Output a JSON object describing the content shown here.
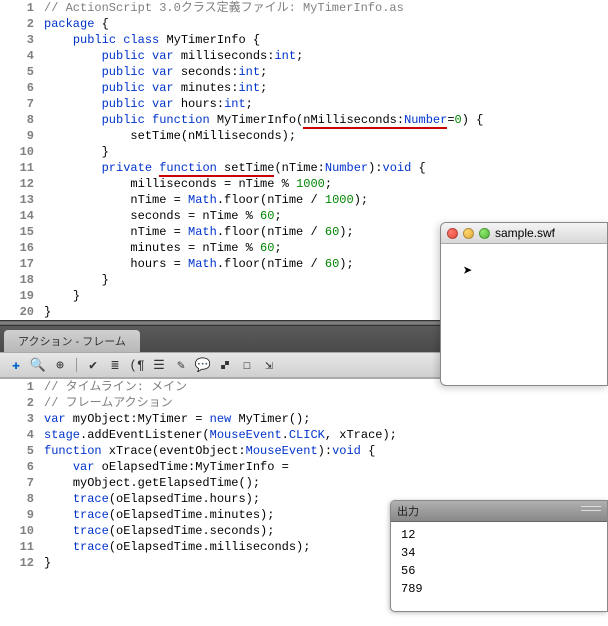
{
  "top_code": [
    {
      "n": 1,
      "tokens": [
        {
          "t": "// ActionScript 3.0クラス定義ファイル: MyTimerInfo.as",
          "c": "cm"
        }
      ],
      "indent": 0
    },
    {
      "n": 2,
      "tokens": [
        {
          "t": "package",
          "c": "kw"
        },
        {
          "t": " {",
          "c": "op"
        }
      ],
      "indent": 0
    },
    {
      "n": 3,
      "tokens": [
        {
          "t": "public",
          "c": "kw"
        },
        {
          "t": " ",
          "c": ""
        },
        {
          "t": "class",
          "c": "kw"
        },
        {
          "t": " MyTimerInfo {",
          "c": "id"
        }
      ],
      "indent": 1
    },
    {
      "n": 4,
      "tokens": [
        {
          "t": "public",
          "c": "kw"
        },
        {
          "t": " ",
          "c": ""
        },
        {
          "t": "var",
          "c": "kw"
        },
        {
          "t": " milliseconds:",
          "c": "id"
        },
        {
          "t": "int",
          "c": "kw"
        },
        {
          "t": ";",
          "c": "op"
        }
      ],
      "indent": 2
    },
    {
      "n": 5,
      "tokens": [
        {
          "t": "public",
          "c": "kw"
        },
        {
          "t": " ",
          "c": ""
        },
        {
          "t": "var",
          "c": "kw"
        },
        {
          "t": " seconds:",
          "c": "id"
        },
        {
          "t": "int",
          "c": "kw"
        },
        {
          "t": ";",
          "c": "op"
        }
      ],
      "indent": 2
    },
    {
      "n": 6,
      "tokens": [
        {
          "t": "public",
          "c": "kw"
        },
        {
          "t": " ",
          "c": ""
        },
        {
          "t": "var",
          "c": "kw"
        },
        {
          "t": " minutes:",
          "c": "id"
        },
        {
          "t": "int",
          "c": "kw"
        },
        {
          "t": ";",
          "c": "op"
        }
      ],
      "indent": 2
    },
    {
      "n": 7,
      "tokens": [
        {
          "t": "public",
          "c": "kw"
        },
        {
          "t": " ",
          "c": ""
        },
        {
          "t": "var",
          "c": "kw"
        },
        {
          "t": " hours:",
          "c": "id"
        },
        {
          "t": "int",
          "c": "kw"
        },
        {
          "t": ";",
          "c": "op"
        }
      ],
      "indent": 2
    },
    {
      "n": 8,
      "tokens": [
        {
          "t": "public",
          "c": "kw"
        },
        {
          "t": " ",
          "c": ""
        },
        {
          "t": "function",
          "c": "kw"
        },
        {
          "t": " MyTimerInfo(",
          "c": "id"
        },
        {
          "t": "nMilliseconds",
          "c": "id err"
        },
        {
          "t": ":",
          "c": "op err"
        },
        {
          "t": "Number",
          "c": "kw err"
        },
        {
          "t": "=",
          "c": "op"
        },
        {
          "t": "0",
          "c": "num"
        },
        {
          "t": ") {",
          "c": "op"
        }
      ],
      "indent": 2
    },
    {
      "n": 9,
      "tokens": [
        {
          "t": "setTime(nMilliseconds);",
          "c": "id"
        }
      ],
      "indent": 3
    },
    {
      "n": 10,
      "tokens": [
        {
          "t": "}",
          "c": "op"
        }
      ],
      "indent": 2
    },
    {
      "n": 11,
      "tokens": [
        {
          "t": "private",
          "c": "kw"
        },
        {
          "t": " ",
          "c": ""
        },
        {
          "t": "function",
          "c": "kw err"
        },
        {
          "t": " ",
          "c": "err"
        },
        {
          "t": "setTime",
          "c": "id err"
        },
        {
          "t": "(nTime:",
          "c": "id"
        },
        {
          "t": "Number",
          "c": "kw"
        },
        {
          "t": "):",
          "c": "op"
        },
        {
          "t": "void",
          "c": "kw"
        },
        {
          "t": " {",
          "c": "op"
        }
      ],
      "indent": 2
    },
    {
      "n": 12,
      "tokens": [
        {
          "t": "milliseconds = nTime % ",
          "c": "id"
        },
        {
          "t": "1000",
          "c": "num"
        },
        {
          "t": ";",
          "c": "op"
        }
      ],
      "indent": 3
    },
    {
      "n": 13,
      "tokens": [
        {
          "t": "nTime = ",
          "c": "id"
        },
        {
          "t": "Math",
          "c": "kw"
        },
        {
          "t": ".floor(nTime / ",
          "c": "id"
        },
        {
          "t": "1000",
          "c": "num"
        },
        {
          "t": ");",
          "c": "op"
        }
      ],
      "indent": 3
    },
    {
      "n": 14,
      "tokens": [
        {
          "t": "seconds = nTime % ",
          "c": "id"
        },
        {
          "t": "60",
          "c": "num"
        },
        {
          "t": ";",
          "c": "op"
        }
      ],
      "indent": 3
    },
    {
      "n": 15,
      "tokens": [
        {
          "t": "nTime = ",
          "c": "id"
        },
        {
          "t": "Math",
          "c": "kw"
        },
        {
          "t": ".floor(nTime / ",
          "c": "id"
        },
        {
          "t": "60",
          "c": "num"
        },
        {
          "t": ");",
          "c": "op"
        }
      ],
      "indent": 3
    },
    {
      "n": 16,
      "tokens": [
        {
          "t": "minutes = nTime % ",
          "c": "id"
        },
        {
          "t": "60",
          "c": "num"
        },
        {
          "t": ";",
          "c": "op"
        }
      ],
      "indent": 3
    },
    {
      "n": 17,
      "tokens": [
        {
          "t": "hours = ",
          "c": "id"
        },
        {
          "t": "Math",
          "c": "kw"
        },
        {
          "t": ".floor(nTime / ",
          "c": "id"
        },
        {
          "t": "60",
          "c": "num"
        },
        {
          "t": ");",
          "c": "op"
        }
      ],
      "indent": 3
    },
    {
      "n": 18,
      "tokens": [
        {
          "t": "}",
          "c": "op"
        }
      ],
      "indent": 2
    },
    {
      "n": 19,
      "tokens": [
        {
          "t": "}",
          "c": "op"
        }
      ],
      "indent": 1
    },
    {
      "n": 20,
      "tokens": [
        {
          "t": "}",
          "c": "op"
        }
      ],
      "indent": 0
    }
  ],
  "panel_tab": "アクション - フレーム",
  "toolbar_icons": [
    "add-icon",
    "search-icon",
    "target-icon",
    "check-icon",
    "wrap-icon",
    "paren-icon",
    "comment-icon",
    "tag-icon",
    "balloon-icon",
    "help-icon",
    "goto-icon",
    "export-icon"
  ],
  "bottom_code": [
    {
      "n": 1,
      "tokens": [
        {
          "t": "// タイムライン: メイン",
          "c": "cm"
        }
      ],
      "indent": 0
    },
    {
      "n": 2,
      "tokens": [
        {
          "t": "// フレームアクション",
          "c": "cm"
        }
      ],
      "indent": 0
    },
    {
      "n": 3,
      "tokens": [
        {
          "t": "var",
          "c": "kw"
        },
        {
          "t": " myObject:MyTimer = ",
          "c": "id"
        },
        {
          "t": "new",
          "c": "kw"
        },
        {
          "t": " MyTimer();",
          "c": "id"
        }
      ],
      "indent": 0
    },
    {
      "n": 4,
      "tokens": [
        {
          "t": "stage",
          "c": "kw"
        },
        {
          "t": ".addEventListener(",
          "c": "id"
        },
        {
          "t": "MouseEvent",
          "c": "kw"
        },
        {
          "t": ".",
          "c": "id"
        },
        {
          "t": "CLICK",
          "c": "kw"
        },
        {
          "t": ", xTrace);",
          "c": "id"
        }
      ],
      "indent": 0
    },
    {
      "n": 5,
      "tokens": [
        {
          "t": "function",
          "c": "kw"
        },
        {
          "t": " xTrace(eventObject:",
          "c": "id"
        },
        {
          "t": "MouseEvent",
          "c": "kw"
        },
        {
          "t": "):",
          "c": "id"
        },
        {
          "t": "void",
          "c": "kw"
        },
        {
          "t": " {",
          "c": "op"
        }
      ],
      "indent": 0
    },
    {
      "n": 6,
      "tokens": [
        {
          "t": "var",
          "c": "kw"
        },
        {
          "t": " oElapsedTime:MyTimerInfo =",
          "c": "id"
        }
      ],
      "indent": 1
    },
    {
      "n": 7,
      "tokens": [
        {
          "t": "myObject.getElapsedTime();",
          "c": "id"
        }
      ],
      "indent": 1
    },
    {
      "n": 8,
      "tokens": [
        {
          "t": "trace",
          "c": "kw"
        },
        {
          "t": "(oElapsedTime.hours);",
          "c": "id"
        }
      ],
      "indent": 1
    },
    {
      "n": 9,
      "tokens": [
        {
          "t": "trace",
          "c": "kw"
        },
        {
          "t": "(oElapsedTime.minutes);",
          "c": "id"
        }
      ],
      "indent": 1
    },
    {
      "n": 10,
      "tokens": [
        {
          "t": "trace",
          "c": "kw"
        },
        {
          "t": "(oElapsedTime.seconds);",
          "c": "id"
        }
      ],
      "indent": 1
    },
    {
      "n": 11,
      "tokens": [
        {
          "t": "trace",
          "c": "kw"
        },
        {
          "t": "(oElapsedTime.milliseconds);",
          "c": "id"
        }
      ],
      "indent": 1
    },
    {
      "n": 12,
      "tokens": [
        {
          "t": "}",
          "c": "op"
        }
      ],
      "indent": 0
    }
  ],
  "float_window": {
    "title": "sample.swf"
  },
  "output_panel": {
    "title": "出力",
    "lines": [
      "12",
      "34",
      "56",
      "789"
    ]
  }
}
